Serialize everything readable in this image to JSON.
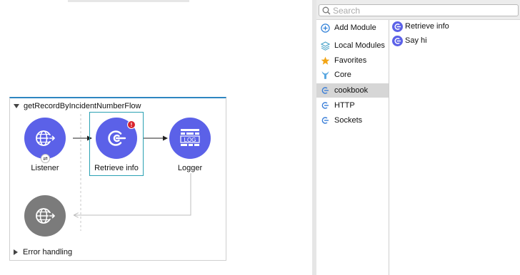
{
  "flow": {
    "name": "getRecordByIncidentNumberFlow",
    "error_handling": "Error handling",
    "nodes": {
      "listener": "Listener",
      "retrieve": "Retrieve info",
      "logger": "Logger",
      "logger_glyph": "LOG"
    },
    "error_badge": "!"
  },
  "palette": {
    "search_placeholder": "Search",
    "groups": [
      {
        "label": "Add Module",
        "icon": "plus-circle-icon"
      },
      {
        "label": "Local Modules",
        "icon": "layers-icon"
      },
      {
        "label": "Favorites",
        "icon": "star-icon"
      },
      {
        "label": "Core",
        "icon": "mule-icon"
      },
      {
        "label": "cookbook",
        "icon": "connector-icon"
      },
      {
        "label": "HTTP",
        "icon": "connector-icon"
      },
      {
        "label": "Sockets",
        "icon": "connector-icon"
      }
    ],
    "selected_group": "cookbook",
    "operations": [
      {
        "label": "Retrieve info",
        "icon": "connector-icon"
      },
      {
        "label": "Say hi",
        "icon": "connector-icon"
      }
    ]
  },
  "colors": {
    "node_blue": "#5b61e8",
    "node_grey": "#7b7b7b",
    "selection": "#2aa1b3",
    "error": "#d9232d",
    "flow_accent": "#2e86c1",
    "favorites_star": "#f2a516",
    "core_icon": "#5aa7e0"
  }
}
